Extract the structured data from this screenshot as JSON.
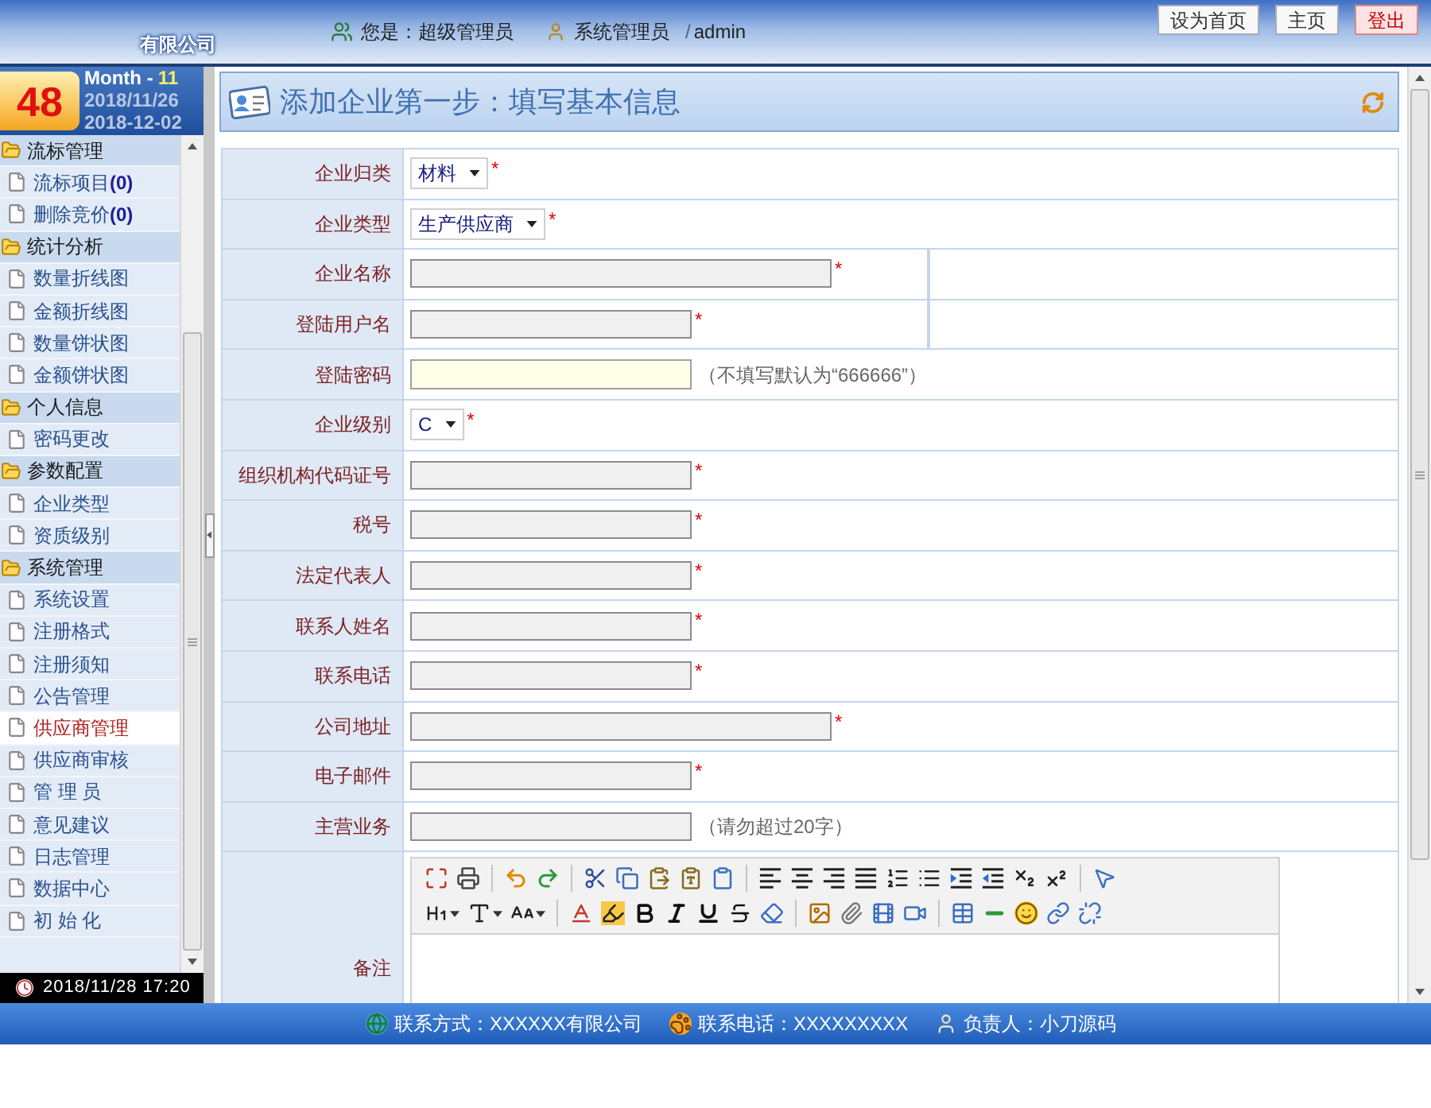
{
  "header": {
    "company": "有限公司",
    "role": "您是：超级管理员",
    "user": "系统管理员",
    "separator": "/",
    "account": "admin",
    "buttons": [
      {
        "label": "设为首页",
        "kind": "normal"
      },
      {
        "label": "主页",
        "kind": "normal"
      },
      {
        "label": "登出",
        "kind": "danger"
      }
    ]
  },
  "calendar": {
    "week": "48",
    "month_label": "Month -",
    "month": "11",
    "start": "2018/11/26",
    "end": "2018-12-02"
  },
  "sidebar": {
    "groups": [
      {
        "label": "流标管理",
        "expanded": true,
        "children": [
          {
            "label": "流标项目**(0)**",
            "selected": false
          },
          {
            "label": "删除竞价**(0)**",
            "selected": false
          }
        ]
      },
      {
        "label": "统计分析",
        "expanded": true,
        "children": [
          {
            "label": "数量折线图",
            "selected": false
          },
          {
            "label": "金额折线图",
            "selected": false
          },
          {
            "label": "数量饼状图",
            "selected": false
          },
          {
            "label": "金额饼状图",
            "selected": false
          }
        ]
      },
      {
        "label": "个人信息",
        "expanded": true,
        "children": [
          {
            "label": "密码更改",
            "selected": false
          }
        ]
      },
      {
        "label": "参数配置",
        "expanded": true,
        "children": [
          {
            "label": "企业类型",
            "selected": false
          },
          {
            "label": "资质级别",
            "selected": false
          }
        ]
      },
      {
        "label": "系统管理",
        "expanded": true,
        "children": [
          {
            "label": "系统设置",
            "selected": false
          },
          {
            "label": "注册格式",
            "selected": false
          },
          {
            "label": "注册须知",
            "selected": false
          },
          {
            "label": "公告管理",
            "selected": false
          },
          {
            "label": "供应商管理",
            "selected": true
          },
          {
            "label": "供应商审核",
            "selected": false
          },
          {
            "label": "管 理 员",
            "selected": false
          },
          {
            "label": "意见建议",
            "selected": false
          },
          {
            "label": "日志管理",
            "selected": false
          },
          {
            "label": "数据中心",
            "selected": false
          },
          {
            "label": "初 始 化",
            "selected": false
          }
        ]
      }
    ]
  },
  "clock": "2018/11/28 17:20",
  "page_title": "添加企业第一步：填写基本信息",
  "form": {
    "rows": [
      {
        "label": "企业归类",
        "kind": "select",
        "value": "材料",
        "required": "*"
      },
      {
        "label": "企业类型",
        "kind": "select",
        "value": "生产供应商",
        "required": "*"
      },
      {
        "label": "企业名称",
        "kind": "text",
        "wide": true,
        "required": "*",
        "split": true
      },
      {
        "label": "登陆用户名",
        "kind": "text",
        "required": "*",
        "split": true
      },
      {
        "label": "登陆密码",
        "kind": "password",
        "hint": "（不填写默认为“666666”）"
      },
      {
        "label": "企业级别",
        "kind": "select",
        "value": "C",
        "required": "*"
      },
      {
        "label": "组织机构代码证号",
        "kind": "text",
        "required": "*"
      },
      {
        "label": "税号",
        "kind": "text",
        "required": "*"
      },
      {
        "label": "法定代表人",
        "kind": "text",
        "required": "*"
      },
      {
        "label": "联系人姓名",
        "kind": "text",
        "required": "*"
      },
      {
        "label": "联系电话",
        "kind": "text",
        "required": "*"
      },
      {
        "label": "公司地址",
        "kind": "text",
        "wide": true,
        "required": "*"
      },
      {
        "label": "电子邮件",
        "kind": "text",
        "required": "*"
      },
      {
        "label": "主营业务",
        "kind": "text",
        "hint": "（请勿超过20字）"
      },
      {
        "label": "备注",
        "kind": "editor"
      }
    ]
  },
  "footer": {
    "items": [
      {
        "kind": "globe",
        "text": "联系方式：XXXXXX有限公司"
      },
      {
        "kind": "paw",
        "text": "联系电话：XXXXXXXXX"
      },
      {
        "kind": "person",
        "text": "负责人：小刀源码"
      }
    ]
  }
}
